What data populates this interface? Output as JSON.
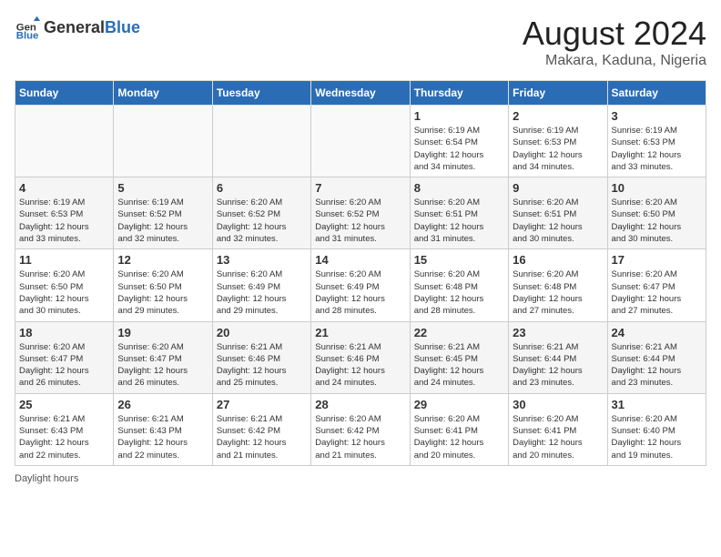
{
  "header": {
    "logo_general": "General",
    "logo_blue": "Blue",
    "title": "August 2024",
    "subtitle": "Makara, Kaduna, Nigeria"
  },
  "weekdays": [
    "Sunday",
    "Monday",
    "Tuesday",
    "Wednesday",
    "Thursday",
    "Friday",
    "Saturday"
  ],
  "weeks": [
    [
      {
        "day": "",
        "detail": ""
      },
      {
        "day": "",
        "detail": ""
      },
      {
        "day": "",
        "detail": ""
      },
      {
        "day": "",
        "detail": ""
      },
      {
        "day": "1",
        "detail": "Sunrise: 6:19 AM\nSunset: 6:54 PM\nDaylight: 12 hours\nand 34 minutes."
      },
      {
        "day": "2",
        "detail": "Sunrise: 6:19 AM\nSunset: 6:53 PM\nDaylight: 12 hours\nand 34 minutes."
      },
      {
        "day": "3",
        "detail": "Sunrise: 6:19 AM\nSunset: 6:53 PM\nDaylight: 12 hours\nand 33 minutes."
      }
    ],
    [
      {
        "day": "4",
        "detail": "Sunrise: 6:19 AM\nSunset: 6:53 PM\nDaylight: 12 hours\nand 33 minutes."
      },
      {
        "day": "5",
        "detail": "Sunrise: 6:19 AM\nSunset: 6:52 PM\nDaylight: 12 hours\nand 32 minutes."
      },
      {
        "day": "6",
        "detail": "Sunrise: 6:20 AM\nSunset: 6:52 PM\nDaylight: 12 hours\nand 32 minutes."
      },
      {
        "day": "7",
        "detail": "Sunrise: 6:20 AM\nSunset: 6:52 PM\nDaylight: 12 hours\nand 31 minutes."
      },
      {
        "day": "8",
        "detail": "Sunrise: 6:20 AM\nSunset: 6:51 PM\nDaylight: 12 hours\nand 31 minutes."
      },
      {
        "day": "9",
        "detail": "Sunrise: 6:20 AM\nSunset: 6:51 PM\nDaylight: 12 hours\nand 30 minutes."
      },
      {
        "day": "10",
        "detail": "Sunrise: 6:20 AM\nSunset: 6:50 PM\nDaylight: 12 hours\nand 30 minutes."
      }
    ],
    [
      {
        "day": "11",
        "detail": "Sunrise: 6:20 AM\nSunset: 6:50 PM\nDaylight: 12 hours\nand 30 minutes."
      },
      {
        "day": "12",
        "detail": "Sunrise: 6:20 AM\nSunset: 6:50 PM\nDaylight: 12 hours\nand 29 minutes."
      },
      {
        "day": "13",
        "detail": "Sunrise: 6:20 AM\nSunset: 6:49 PM\nDaylight: 12 hours\nand 29 minutes."
      },
      {
        "day": "14",
        "detail": "Sunrise: 6:20 AM\nSunset: 6:49 PM\nDaylight: 12 hours\nand 28 minutes."
      },
      {
        "day": "15",
        "detail": "Sunrise: 6:20 AM\nSunset: 6:48 PM\nDaylight: 12 hours\nand 28 minutes."
      },
      {
        "day": "16",
        "detail": "Sunrise: 6:20 AM\nSunset: 6:48 PM\nDaylight: 12 hours\nand 27 minutes."
      },
      {
        "day": "17",
        "detail": "Sunrise: 6:20 AM\nSunset: 6:47 PM\nDaylight: 12 hours\nand 27 minutes."
      }
    ],
    [
      {
        "day": "18",
        "detail": "Sunrise: 6:20 AM\nSunset: 6:47 PM\nDaylight: 12 hours\nand 26 minutes."
      },
      {
        "day": "19",
        "detail": "Sunrise: 6:20 AM\nSunset: 6:47 PM\nDaylight: 12 hours\nand 26 minutes."
      },
      {
        "day": "20",
        "detail": "Sunrise: 6:21 AM\nSunset: 6:46 PM\nDaylight: 12 hours\nand 25 minutes."
      },
      {
        "day": "21",
        "detail": "Sunrise: 6:21 AM\nSunset: 6:46 PM\nDaylight: 12 hours\nand 24 minutes."
      },
      {
        "day": "22",
        "detail": "Sunrise: 6:21 AM\nSunset: 6:45 PM\nDaylight: 12 hours\nand 24 minutes."
      },
      {
        "day": "23",
        "detail": "Sunrise: 6:21 AM\nSunset: 6:44 PM\nDaylight: 12 hours\nand 23 minutes."
      },
      {
        "day": "24",
        "detail": "Sunrise: 6:21 AM\nSunset: 6:44 PM\nDaylight: 12 hours\nand 23 minutes."
      }
    ],
    [
      {
        "day": "25",
        "detail": "Sunrise: 6:21 AM\nSunset: 6:43 PM\nDaylight: 12 hours\nand 22 minutes."
      },
      {
        "day": "26",
        "detail": "Sunrise: 6:21 AM\nSunset: 6:43 PM\nDaylight: 12 hours\nand 22 minutes."
      },
      {
        "day": "27",
        "detail": "Sunrise: 6:21 AM\nSunset: 6:42 PM\nDaylight: 12 hours\nand 21 minutes."
      },
      {
        "day": "28",
        "detail": "Sunrise: 6:20 AM\nSunset: 6:42 PM\nDaylight: 12 hours\nand 21 minutes."
      },
      {
        "day": "29",
        "detail": "Sunrise: 6:20 AM\nSunset: 6:41 PM\nDaylight: 12 hours\nand 20 minutes."
      },
      {
        "day": "30",
        "detail": "Sunrise: 6:20 AM\nSunset: 6:41 PM\nDaylight: 12 hours\nand 20 minutes."
      },
      {
        "day": "31",
        "detail": "Sunrise: 6:20 AM\nSunset: 6:40 PM\nDaylight: 12 hours\nand 19 minutes."
      }
    ]
  ],
  "footer": "Daylight hours"
}
